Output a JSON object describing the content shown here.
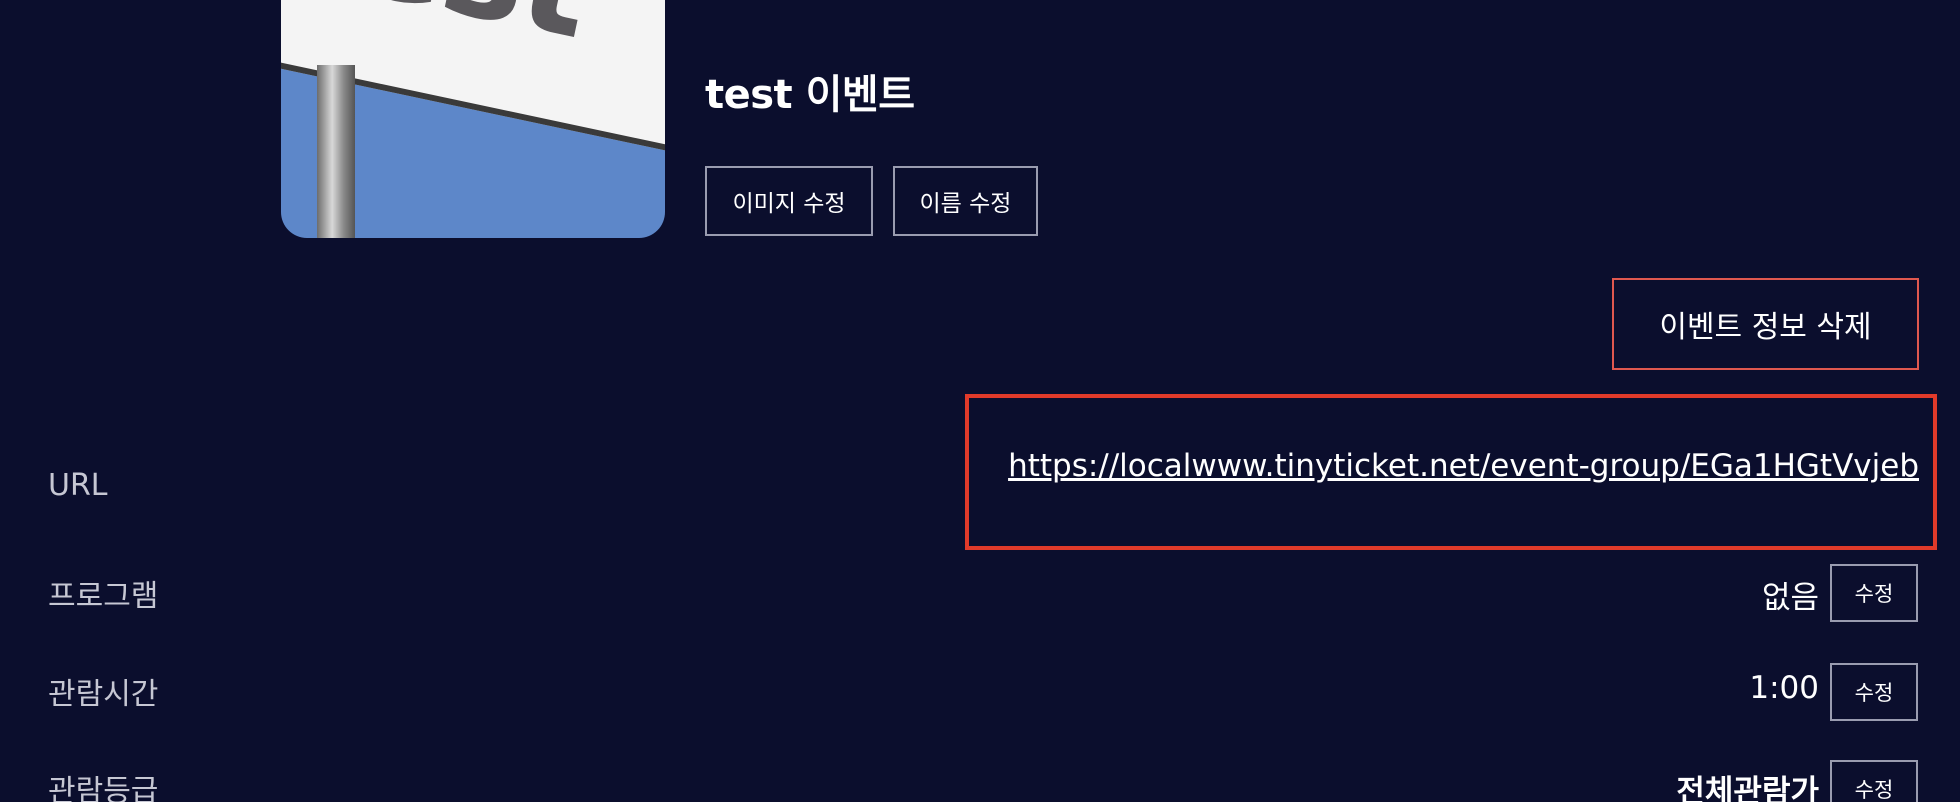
{
  "event": {
    "title": "test 이벤트",
    "image_sign_text": "test"
  },
  "actions": {
    "edit_image": "이미지 수정",
    "edit_name": "이름 수정",
    "delete_event": "이벤트 정보 삭제"
  },
  "details": {
    "url": {
      "label": "URL",
      "value": "https://localwww.tinyticket.net/event-group/EGa1HGtVvjeb"
    },
    "program": {
      "label": "프로그램",
      "value": "없음",
      "edit": "수정"
    },
    "duration": {
      "label": "관람시간",
      "value": "1:00",
      "edit": "수정"
    },
    "rating": {
      "label": "관람등급",
      "value": "전체관람가",
      "edit": "수정"
    }
  },
  "colors": {
    "background": "#0b0e2d",
    "danger_border": "#e0584f",
    "highlight": "#e13a2a"
  }
}
